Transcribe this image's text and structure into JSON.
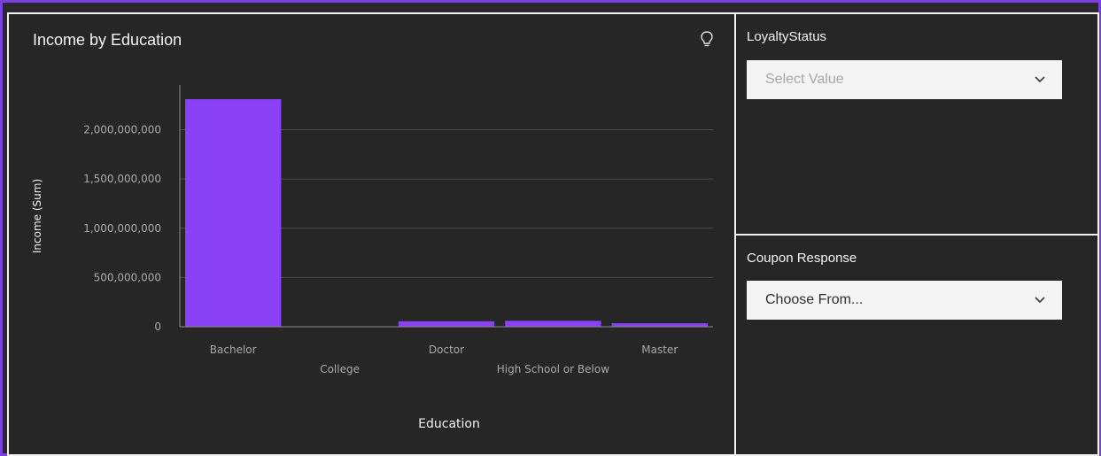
{
  "widget": {
    "title": "Income by Education",
    "insight_icon": "lightbulb-icon"
  },
  "filters": {
    "loyalty": {
      "title": "LoyaltyStatus",
      "placeholder": "Select Value"
    },
    "coupon": {
      "title": "Coupon Response",
      "value": "Choose From..."
    },
    "dropdown_icon": "chevron-down-icon"
  },
  "colors": {
    "bar": "#8a40f5",
    "accent_border": "#7b3fe4",
    "panel_bg": "#262626",
    "axis_text": "#a8a8a8",
    "grid": "#4a4a4a"
  },
  "chart_data": {
    "type": "bar",
    "title": "Income by Education",
    "xlabel": "Education",
    "ylabel": "Income (Sum)",
    "categories": [
      "Bachelor",
      "College",
      "Doctor",
      "High School or Below",
      "Master"
    ],
    "values": [
      2310000000,
      0,
      55000000,
      60000000,
      35000000
    ],
    "ylim": [
      0,
      2400000000
    ],
    "yticks": [
      0,
      500000000,
      1000000000,
      1500000000,
      2000000000
    ],
    "ytick_labels": [
      "0",
      "500,000,000",
      "1,000,000,000",
      "1,500,000,000",
      "2,000,000,000"
    ],
    "grid": true,
    "legend": "none"
  }
}
